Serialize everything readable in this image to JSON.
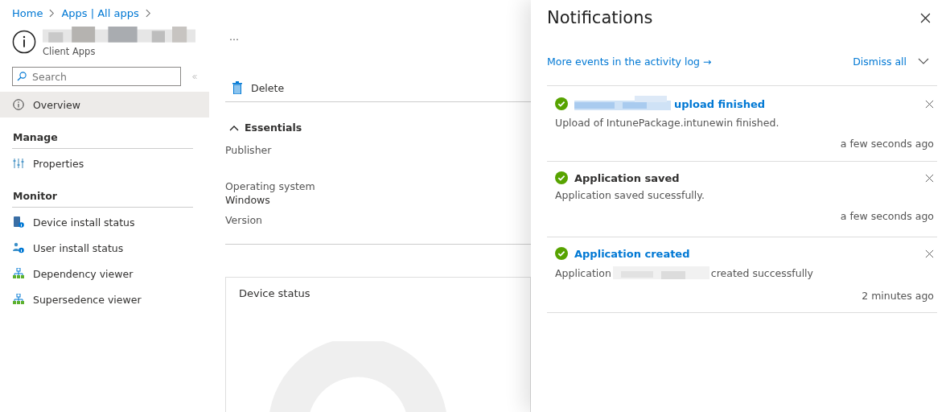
{
  "breadcrumb": [
    {
      "label": "Home"
    },
    {
      "label": "Apps | All apps"
    }
  ],
  "header": {
    "title_redacted": true,
    "subtitle": "Client Apps",
    "more": "..."
  },
  "search": {
    "placeholder": "Search"
  },
  "sidebar": {
    "items": [
      {
        "label": "Overview",
        "kind": "info",
        "selected": true
      }
    ],
    "sections": [
      {
        "title": "Manage",
        "items": [
          {
            "label": "Properties",
            "kind": "sliders",
            "selected": false
          }
        ]
      },
      {
        "title": "Monitor",
        "items": [
          {
            "label": "Device install status",
            "kind": "device",
            "selected": false
          },
          {
            "label": "User install status",
            "kind": "user",
            "selected": false
          },
          {
            "label": "Dependency viewer",
            "kind": "tree",
            "selected": false
          },
          {
            "label": "Supersedence viewer",
            "kind": "tree",
            "selected": false
          }
        ]
      }
    ]
  },
  "toolbar": [
    {
      "label": "Delete"
    }
  ],
  "essentials": {
    "title": "Essentials",
    "expanded": true,
    "fields": [
      {
        "label": "Publisher"
      },
      {
        "label": "Operating system",
        "value": "Windows"
      },
      {
        "label": "Version"
      }
    ]
  },
  "device_status": {
    "title": "Device status"
  },
  "notifications": {
    "title": "Notifications",
    "activity_link": "More events in the activity log →",
    "dismiss": "Dismiss all",
    "items": [
      {
        "title": "upload finished",
        "title_redacted": true,
        "kind": "link",
        "body": [
          {
            "kind": "text",
            "text": "Upload of IntunePackage.intunewin finished."
          }
        ],
        "time": "a few seconds ago"
      },
      {
        "title": "Application saved",
        "title_redacted": false,
        "kind": "plain",
        "body": [
          {
            "kind": "text",
            "text": "Application saved sucessfully."
          }
        ],
        "time": "a few seconds ago"
      },
      {
        "title": "Application created",
        "title_redacted": false,
        "kind": "link",
        "body": [
          {
            "kind": "text",
            "text": "Application"
          },
          {
            "kind": "redacted"
          },
          {
            "kind": "text",
            "text": "created successfully"
          }
        ],
        "time": "2 minutes ago"
      }
    ]
  }
}
